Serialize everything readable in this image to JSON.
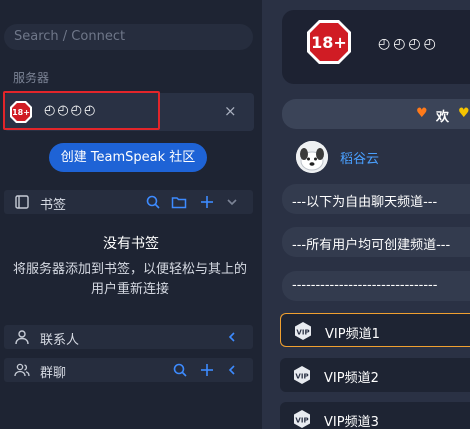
{
  "search": {
    "placeholder": "Search / Connect"
  },
  "servers": {
    "section_label": "服务器",
    "item": {
      "logo_text": "18+",
      "name": "◴◴◴◴",
      "close_label": "×"
    }
  },
  "create_button": "创建 TeamSpeak 社区",
  "bookmarks": {
    "label": "书签",
    "empty_title": "没有书签",
    "empty_desc": "将服务器添加到书签，以便轻松与其上的用户重新连接"
  },
  "contacts": {
    "label": "联系人"
  },
  "group_chat": {
    "label": "群聊"
  },
  "header": {
    "logo_text": "18+",
    "name": "◴◴◴◴"
  },
  "banner": {
    "text": "欢"
  },
  "user": {
    "name": "稻谷云"
  },
  "channels": [
    {
      "label": "---以下为自由聊天频道---"
    },
    {
      "label": "---所有用户均可创建频道---"
    },
    {
      "label": "-------------------------------"
    }
  ],
  "vip_channels": [
    {
      "label": "VIP频道1"
    },
    {
      "label": "VIP频道2"
    },
    {
      "label": "VIP频道3"
    }
  ],
  "colors": {
    "accent": "#1e63d6",
    "highlight": "#e2252a",
    "link": "#4aa0ff",
    "active_border": "#f0a030"
  }
}
